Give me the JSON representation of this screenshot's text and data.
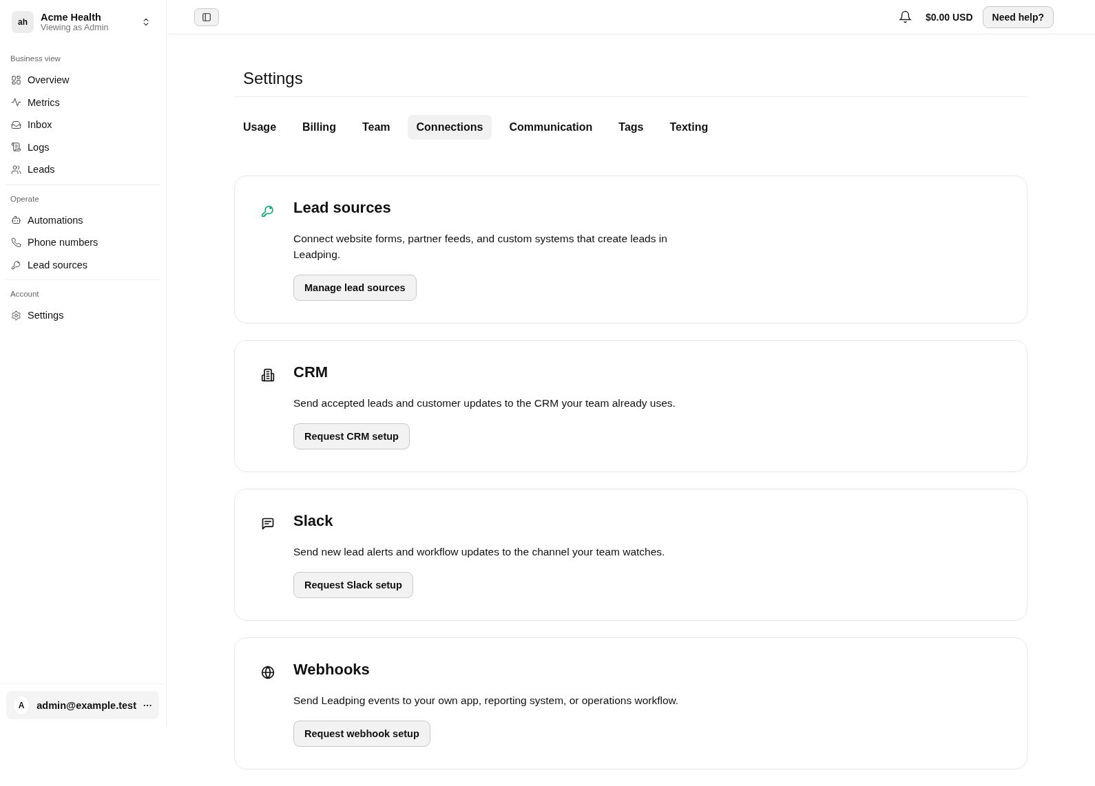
{
  "workspace": {
    "avatar": "ah",
    "name": "Acme Health",
    "subtitle": "Viewing as Admin"
  },
  "sidebar": {
    "groups": [
      {
        "label": "Business view",
        "items": [
          {
            "kind": "grid",
            "label": "Overview"
          },
          {
            "kind": "pulse",
            "label": "Metrics"
          },
          {
            "kind": "inbox",
            "label": "Inbox"
          },
          {
            "kind": "scroll",
            "label": "Logs"
          },
          {
            "kind": "users",
            "label": "Leads"
          }
        ]
      },
      {
        "label": "Operate",
        "items": [
          {
            "kind": "bot",
            "label": "Automations"
          },
          {
            "kind": "phone",
            "label": "Phone numbers"
          },
          {
            "kind": "key",
            "label": "Lead sources"
          }
        ]
      },
      {
        "label": "Account",
        "items": [
          {
            "kind": "gear",
            "label": "Settings"
          }
        ]
      }
    ]
  },
  "user": {
    "avatar": "A",
    "email": "admin@example.test",
    "menu": "···"
  },
  "topbar": {
    "balance": "$0.00 USD",
    "help": "Need help?"
  },
  "page": {
    "title": "Settings"
  },
  "tabs": [
    {
      "label": "Usage",
      "selected": false
    },
    {
      "label": "Billing",
      "selected": false
    },
    {
      "label": "Team",
      "selected": false
    },
    {
      "label": "Connections",
      "selected": true
    },
    {
      "label": "Communication",
      "selected": false
    },
    {
      "label": "Tags",
      "selected": false
    },
    {
      "label": "Texting",
      "selected": false
    }
  ],
  "cards": [
    {
      "kind": "key",
      "color": "#16a673",
      "title": "Lead sources",
      "text": "Connect website forms, partner feeds, and custom systems that create leads in Leadping.",
      "button": "Manage lead sources"
    },
    {
      "kind": "building",
      "color": "#111111",
      "title": "CRM",
      "text": "Send accepted leads and customer updates to the CRM your team already uses.",
      "button": "Request CRM setup"
    },
    {
      "kind": "message",
      "color": "#111111",
      "title": "Slack",
      "text": "Send new lead alerts and workflow updates to the channel your team watches.",
      "button": "Request Slack setup"
    },
    {
      "kind": "globe",
      "color": "#111111",
      "title": "Webhooks",
      "text": "Send Leadping events to your own app, reporting system, or operations workflow.",
      "button": "Request webhook setup"
    }
  ]
}
